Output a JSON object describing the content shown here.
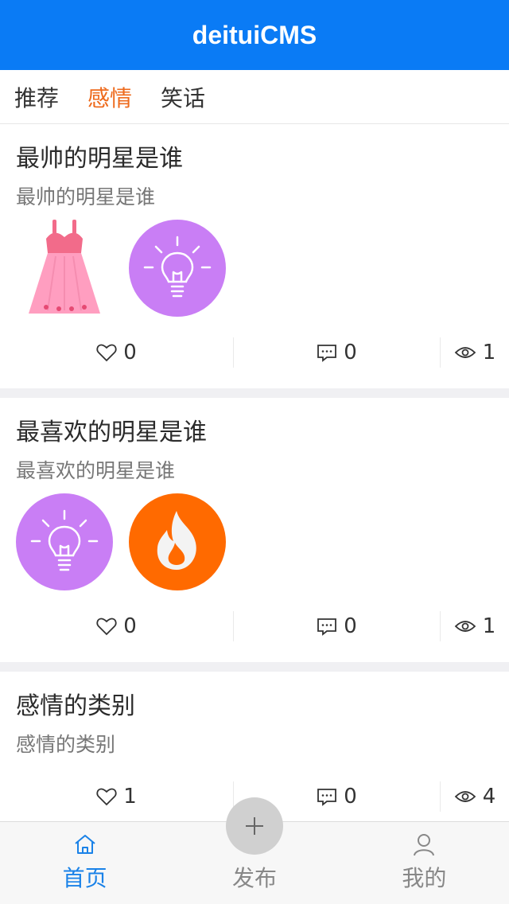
{
  "header": {
    "title": "deituiCMS"
  },
  "tabs": [
    {
      "label": "推荐",
      "active": false
    },
    {
      "label": "感情",
      "active": true
    },
    {
      "label": "笑话",
      "active": false
    }
  ],
  "posts": [
    {
      "title": "最帅的明星是谁",
      "desc": "最帅的明星是谁",
      "images": [
        "dress-icon",
        "lightbulb-icon"
      ],
      "likes": "0",
      "comments": "0",
      "views": "1"
    },
    {
      "title": "最喜欢的明星是谁",
      "desc": "最喜欢的明星是谁",
      "images": [
        "lightbulb-icon",
        "fire-icon"
      ],
      "likes": "0",
      "comments": "0",
      "views": "1"
    },
    {
      "title": "感情的类别",
      "desc": "感情的类别",
      "images": [],
      "likes": "1",
      "comments": "0",
      "views": "4"
    }
  ],
  "tabbar": {
    "home": "首页",
    "publish": "发布",
    "mine": "我的"
  },
  "colors": {
    "header": "#0a7bf5",
    "active_tab": "#ee6a1c",
    "tabbar_active": "#1a82e8",
    "bulb_bg": "#c97ef5",
    "fire_bg": "#ff6a00"
  }
}
